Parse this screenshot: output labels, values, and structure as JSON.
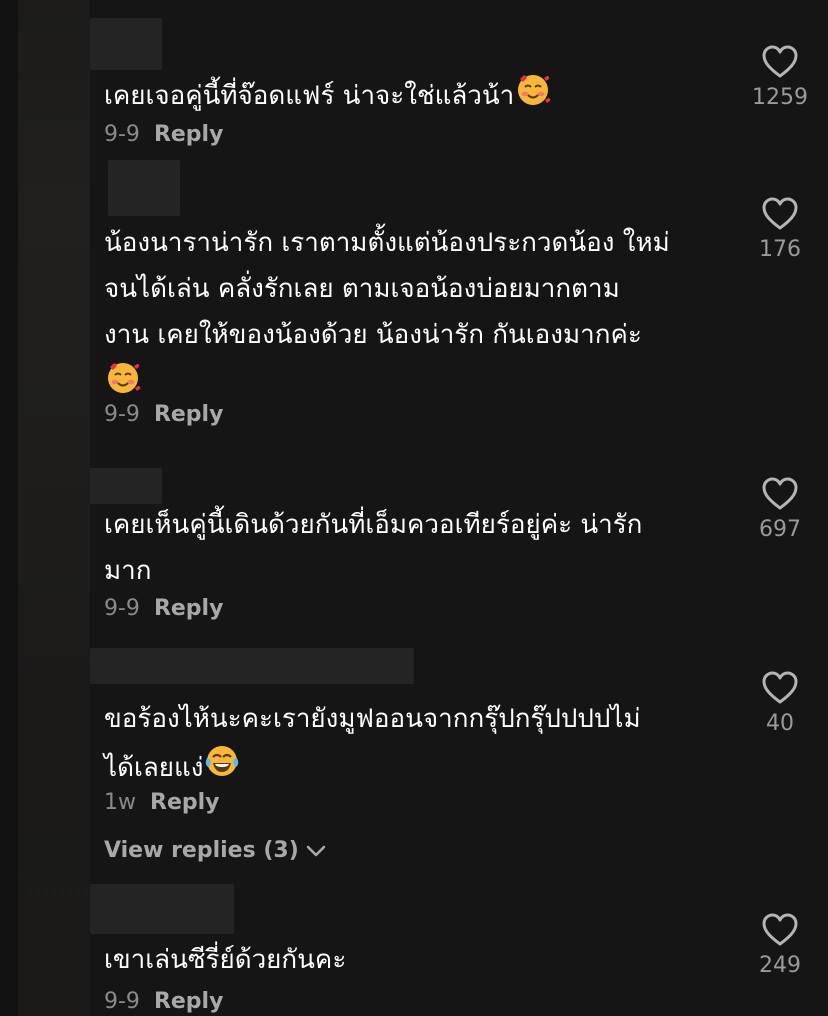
{
  "icons": {
    "like": "heart-outline-icon",
    "expand": "chevron-down-icon",
    "smiling_hearts": "smiling-face-with-hearts-emoji",
    "tears_of_joy": "face-with-tears-of-joy-emoji"
  },
  "colors": {
    "background": "#121212",
    "text_primary": "#ffffff",
    "text_secondary": "#8a8a8a",
    "reply": "#a8a8a8"
  },
  "reply_label": "Reply",
  "comments": [
    {
      "text": "เคยเจอคู่นี้ที่จ๊อดแฟร์ น่าจะใช่แล้วน้า",
      "emoji": "smiling-face-with-hearts-emoji",
      "date": "9-9",
      "likes": "1259"
    },
    {
      "text": "น้องนาราน่ารัก  เราตามตั้งแต่น้องประกวดน้อง ใหม่\nจนได้เล่น  คลั่งรักเลย  ตามเจอน้องบ่อยมากตาม\nงาน เคยให้ของน้องด้วย  น้องน่ารัก กันเองมากค่ะ",
      "emoji": "smiling-face-with-hearts-emoji",
      "date": "9-9",
      "likes": "176"
    },
    {
      "text": "เคยเห็นคู่นี้เดินด้วยกันที่เอ็มควอเทียร์อยู่ค่ะ น่ารัก\nมาก",
      "emoji": "",
      "date": "9-9",
      "likes": "697"
    },
    {
      "text": "ขอร้องไห้นะคะเรายังมูฟออนจากกรุ๊ปกรุ๊ปปปปไม่\nได้เลยแง่",
      "emoji": "face-with-tears-of-joy-emoji",
      "date": "1w",
      "likes": "40",
      "view_replies": "View replies (3)"
    },
    {
      "text": "เขาเล่นซีรี่ย์ด้วยกันคะ",
      "emoji": "",
      "date": "9-9",
      "likes": "249"
    }
  ]
}
